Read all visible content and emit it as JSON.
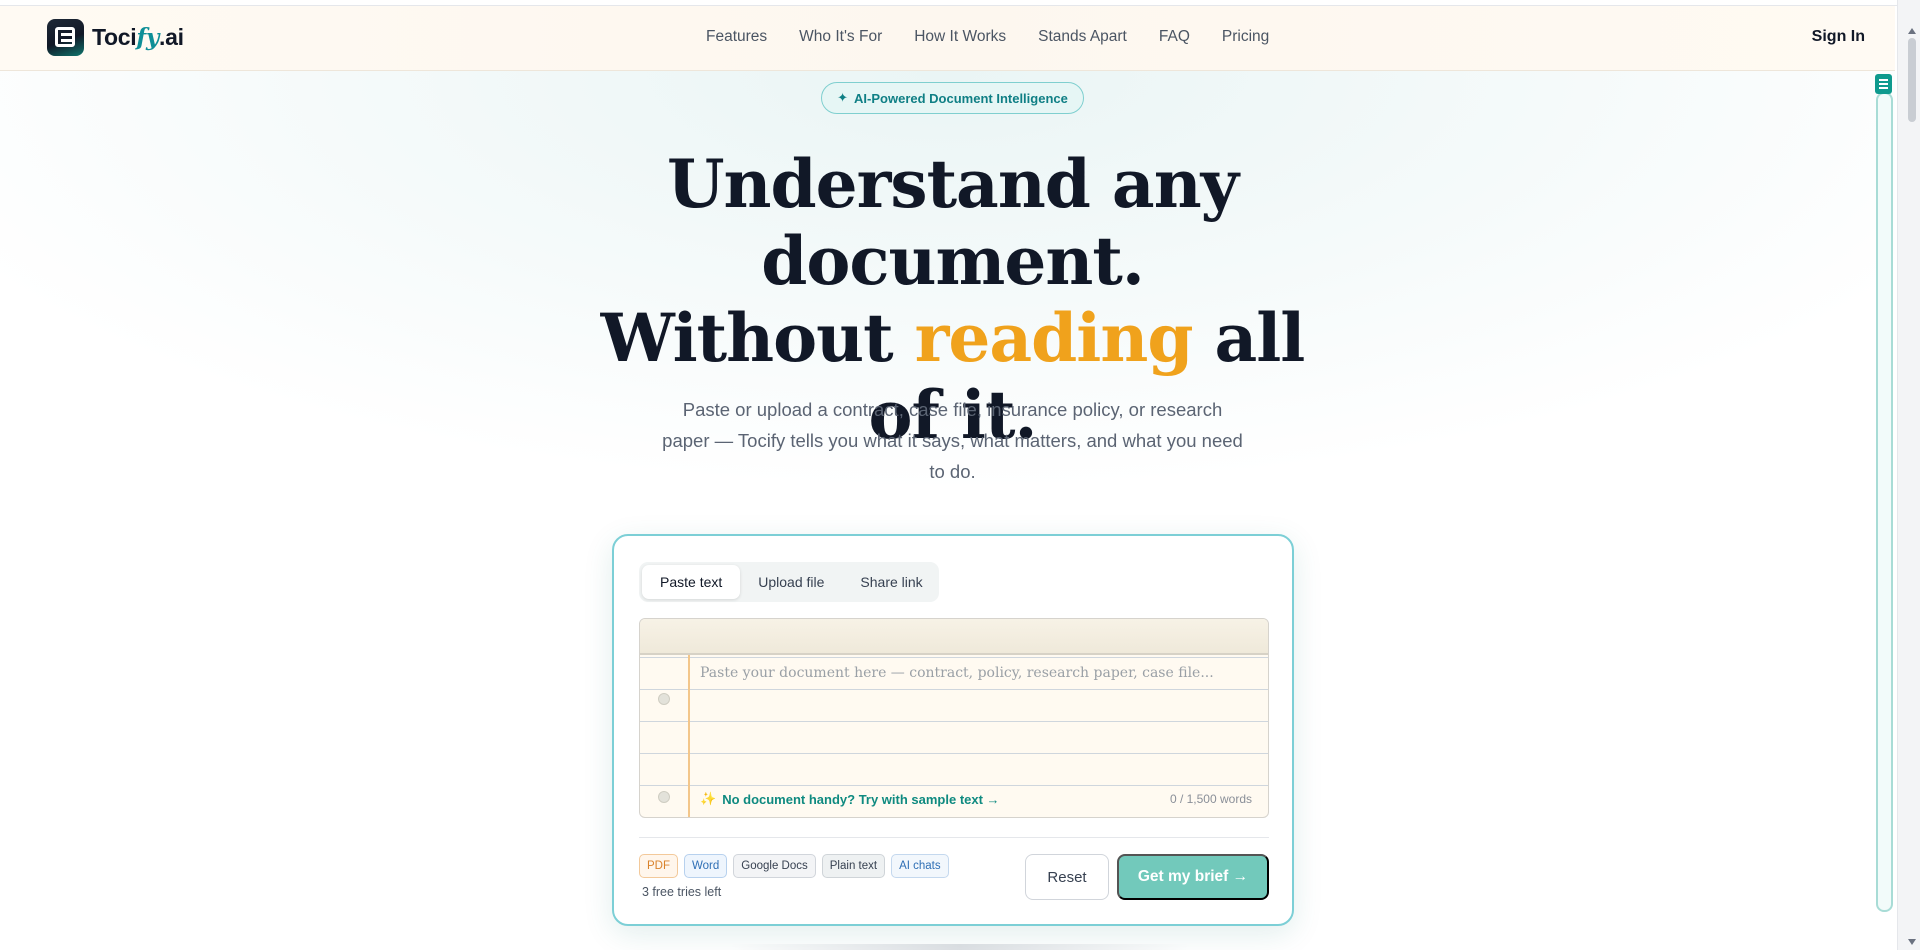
{
  "brand": {
    "name_prefix": "Toci",
    "name_accent": "fy",
    "name_suffix": ".ai"
  },
  "nav": {
    "links": [
      "Features",
      "Who It's For",
      "How It Works",
      "Stands Apart",
      "FAQ",
      "Pricing"
    ],
    "sign_in": "Sign In"
  },
  "hero": {
    "badge": "AI-Powered Document Intelligence",
    "badge_icon": "✦",
    "headline_line1": "Understand any document.",
    "headline_line2_pre": "Without ",
    "headline_line2_accent": "reading",
    "headline_line2_post": " all of it.",
    "subhead": "Paste or upload a contract, case file, insurance policy, or research paper — Tocify tells you what it says, what matters, and what you need to do."
  },
  "card": {
    "tabs": [
      "Paste text",
      "Upload file",
      "Share link"
    ],
    "active_tab": "Paste text",
    "placeholder": "Paste your document here — contract, policy, research paper, case file...",
    "sample_icon": "✨",
    "sample_link": "No document handy? Try with sample text →",
    "word_count": "0 / 1,500 words",
    "formats": [
      "PDF",
      "Word",
      "Google Docs",
      "Plain text",
      "AI chats"
    ],
    "tries_left": "3 free tries left",
    "reset": "Reset",
    "submit": "Get my brief →"
  },
  "colors": {
    "accent_teal": "#0f8a80",
    "accent_orange": "#f0a21c",
    "button_teal": "#72c9bb"
  }
}
